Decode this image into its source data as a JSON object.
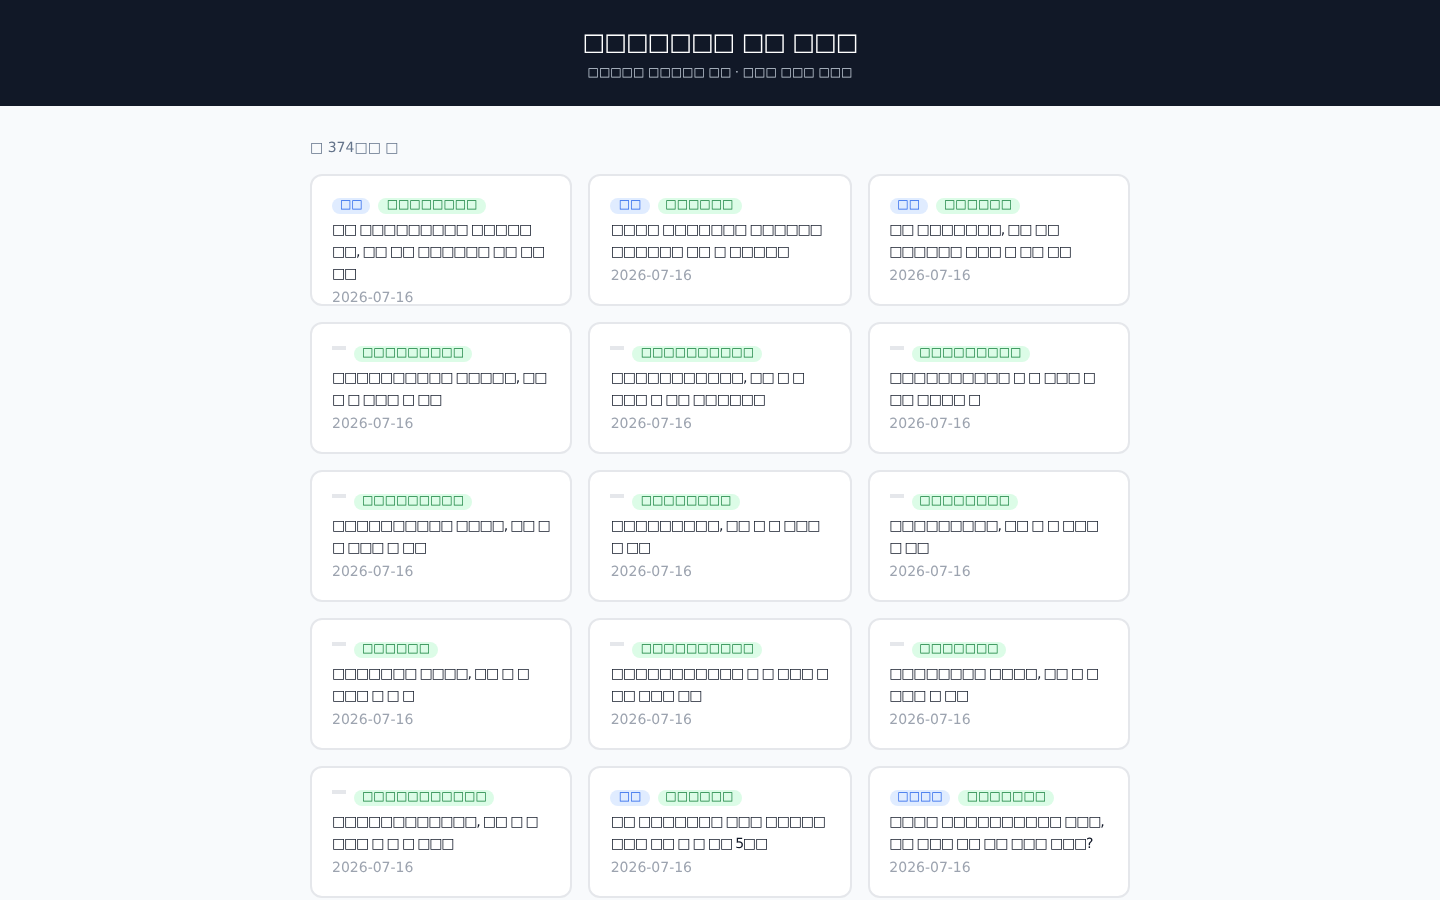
{
  "header": {
    "title": "□□□□□□□ □□ □□□",
    "subtitle": "□□□□□ □□□□□ □□ · □□□ □□□ □□□"
  },
  "count": "□ 374□□ □",
  "cards": [
    {
      "tags": [
        {
          "kind": "source",
          "text": "□□"
        },
        {
          "kind": "category",
          "text": "□□□□□□□□"
        }
      ],
      "title": "□□ □□□□□□□□□ □□□□□ □□, □□ □□ □□□□□□ □□ □□ □□",
      "date": "2026-07-16"
    },
    {
      "tags": [
        {
          "kind": "source",
          "text": "□□"
        },
        {
          "kind": "category",
          "text": "□□□□□□"
        }
      ],
      "title": "□□□□ □□□□□□□ □□□□□□ □□□□□□ □□ □ □□□□□",
      "date": "2026-07-16"
    },
    {
      "tags": [
        {
          "kind": "source",
          "text": "□□"
        },
        {
          "kind": "category",
          "text": "□□□□□□"
        }
      ],
      "title": "□□ □□□□□□□, □□ □□ □□□□□□ □□□ □ □□ □□",
      "date": "2026-07-16"
    },
    {
      "tags": [
        {
          "kind": "blank"
        },
        {
          "kind": "category",
          "text": "□□□□□□□□□"
        }
      ],
      "title": "□□□□□□□□□□ □□□□□, □□ □ □ □□□ □ □□",
      "date": "2026-07-16"
    },
    {
      "tags": [
        {
          "kind": "blank"
        },
        {
          "kind": "category",
          "text": "□□□□□□□□□□"
        }
      ],
      "title": "□□□□□□□□□□□, □□ □ □ □□□ □ □□ □□□□□□",
      "date": "2026-07-16"
    },
    {
      "tags": [
        {
          "kind": "blank"
        },
        {
          "kind": "category",
          "text": "□□□□□□□□□"
        }
      ],
      "title": "□□□□□□□□□□ □ □ □□□ □ □□ □□□□ □",
      "date": "2026-07-16"
    },
    {
      "tags": [
        {
          "kind": "blank"
        },
        {
          "kind": "category",
          "text": "□□□□□□□□□"
        }
      ],
      "title": "□□□□□□□□□□ □□□□, □□ □ □ □□□ □ □□",
      "date": "2026-07-16"
    },
    {
      "tags": [
        {
          "kind": "blank"
        },
        {
          "kind": "category",
          "text": "□□□□□□□□"
        }
      ],
      "title": "□□□□□□□□□, □□ □ □ □□□ □ □□",
      "date": "2026-07-16"
    },
    {
      "tags": [
        {
          "kind": "blank"
        },
        {
          "kind": "category",
          "text": "□□□□□□□□"
        }
      ],
      "title": "□□□□□□□□□, □□ □ □ □□□ □ □□",
      "date": "2026-07-16"
    },
    {
      "tags": [
        {
          "kind": "blank"
        },
        {
          "kind": "category",
          "text": "□□□□□□"
        }
      ],
      "title": "□□□□□□□ □□□□, □□ □ □ □□□ □ □ □",
      "date": "2026-07-16"
    },
    {
      "tags": [
        {
          "kind": "blank"
        },
        {
          "kind": "category",
          "text": "□□□□□□□□□□"
        }
      ],
      "title": "□□□□□□□□□□□ □ □ □□□ □ □□ □□□ □□",
      "date": "2026-07-16"
    },
    {
      "tags": [
        {
          "kind": "blank"
        },
        {
          "kind": "category",
          "text": "□□□□□□□"
        }
      ],
      "title": "□□□□□□□□ □□□□, □□ □ □ □□□ □ □□",
      "date": "2026-07-16"
    },
    {
      "tags": [
        {
          "kind": "blank"
        },
        {
          "kind": "category",
          "text": "□□□□□□□□□□□"
        }
      ],
      "title": "□□□□□□□□□□□□, □□ □ □ □□□ □ □ □ □□□",
      "date": "2026-07-16"
    },
    {
      "tags": [
        {
          "kind": "source",
          "text": "□□"
        },
        {
          "kind": "category",
          "text": "□□□□□□"
        }
      ],
      "title": "□□ □□□□□□□ □□□ □□□□□ □□□ □□ □ □ □□ 5□□",
      "date": "2026-07-16"
    },
    {
      "tags": [
        {
          "kind": "source",
          "text": "□□□□"
        },
        {
          "kind": "category",
          "text": "□□□□□□□"
        }
      ],
      "title": "□□□□ □□□□□□□□□□ □□□, □□ □□□ □□ □□ □□□ □□□?",
      "date": "2026-07-16"
    }
  ]
}
